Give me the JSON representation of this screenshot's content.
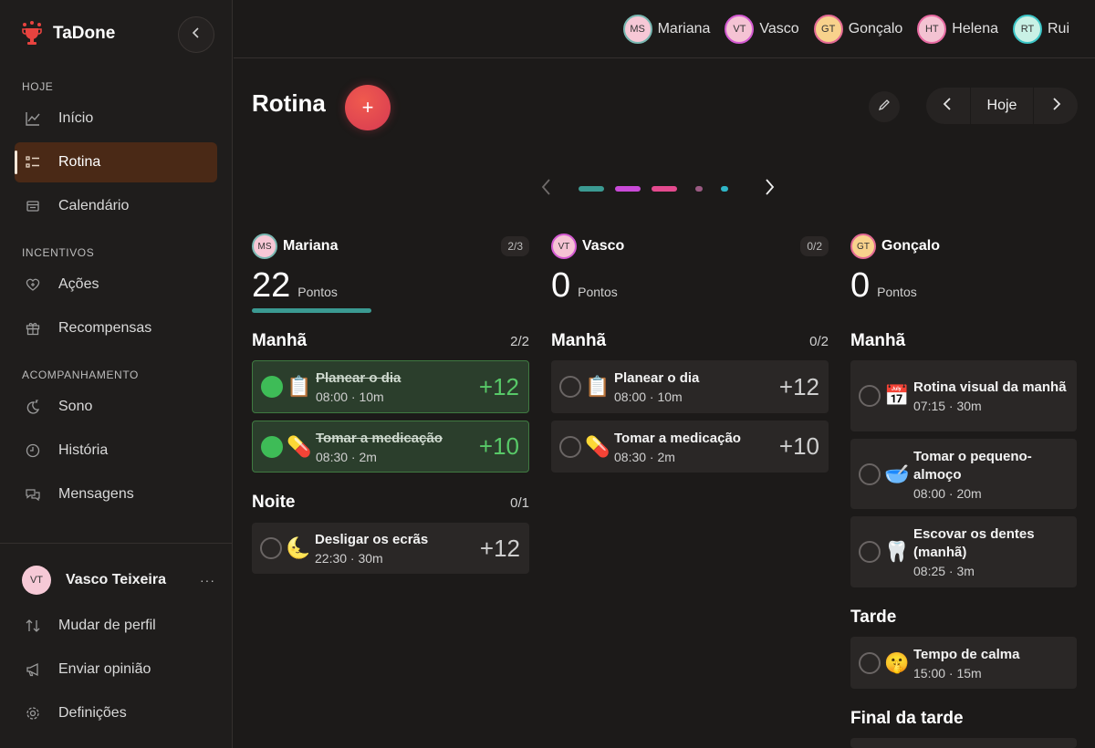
{
  "app": {
    "name": "TaDone"
  },
  "sidebar": {
    "sections": {
      "hoje": "HOJE",
      "incentivos": "INCENTIVOS",
      "acompanhamento": "ACOMPANHAMENTO"
    },
    "items": {
      "inicio": "Início",
      "rotina": "Rotina",
      "calendario": "Calendário",
      "acoes": "Ações",
      "recompensas": "Recompensas",
      "sono": "Sono",
      "historia": "História",
      "mensagens": "Mensagens"
    },
    "user": {
      "initials": "VT",
      "name": "Vasco Teixeira",
      "more": "···"
    },
    "footer": {
      "mudar_perfil": "Mudar de perfil",
      "enviar_opiniao": "Enviar opinião",
      "definicoes": "Definições"
    }
  },
  "topbar": {
    "people": [
      {
        "initials": "MS",
        "name": "Mariana"
      },
      {
        "initials": "VT",
        "name": "Vasco"
      },
      {
        "initials": "GT",
        "name": "Gonçalo"
      },
      {
        "initials": "HT",
        "name": "Helena"
      },
      {
        "initials": "RT",
        "name": "Rui"
      }
    ]
  },
  "header": {
    "title": "Rotina",
    "add": "+",
    "today": "Hoje"
  },
  "pager": {
    "dot_colors": [
      "#3b9a92",
      "#c94ad8",
      "#e44a8e",
      "#9a5a82",
      "#2fb5c6"
    ]
  },
  "points_label": "Pontos",
  "columns": {
    "mariana": {
      "initials": "MS",
      "name": "Mariana",
      "count": "2/3",
      "points": "22",
      "progress": 0.67,
      "sections": {
        "manha": {
          "title": "Manhã",
          "count": "2/2"
        },
        "noite": {
          "title": "Noite",
          "count": "0/1"
        }
      },
      "tasks": [
        {
          "emoji": "📋",
          "name": "Planear o dia",
          "meta": "08:00 · 10m",
          "pts": "+12",
          "done": true
        },
        {
          "emoji": "💊",
          "name": "Tomar a medicação",
          "meta": "08:30 · 2m",
          "pts": "+10",
          "done": true
        },
        {
          "emoji": "🌜",
          "name": "Desligar os ecrãs",
          "meta": "22:30 · 30m",
          "pts": "+12",
          "done": false
        }
      ]
    },
    "vasco": {
      "initials": "VT",
      "name": "Vasco",
      "count": "0/2",
      "points": "0",
      "sections": {
        "manha": {
          "title": "Manhã",
          "count": "0/2"
        }
      },
      "tasks": [
        {
          "emoji": "📋",
          "name": "Planear o dia",
          "meta": "08:00 · 10m",
          "pts": "+12",
          "done": false
        },
        {
          "emoji": "💊",
          "name": "Tomar a medicação",
          "meta": "08:30 · 2m",
          "pts": "+10",
          "done": false
        }
      ]
    },
    "goncalo": {
      "initials": "GT",
      "name": "Gonçalo",
      "points": "0",
      "sections": {
        "manha": {
          "title": "Manhã"
        },
        "tarde": {
          "title": "Tarde"
        },
        "final_tarde": {
          "title": "Final da tarde"
        }
      },
      "tasks": [
        {
          "emoji": "📅",
          "name": "Rotina visual da manhã",
          "meta": "07:15 · 30m"
        },
        {
          "emoji": "🥣",
          "name": "Tomar o pequeno-almoço",
          "meta": "08:00 · 20m"
        },
        {
          "emoji": "🦷",
          "name": "Escovar os dentes (manhã)",
          "meta": "08:25 · 3m"
        },
        {
          "emoji": "🤫",
          "name": "Tempo de calma",
          "meta": "15:00 · 15m"
        }
      ]
    }
  }
}
